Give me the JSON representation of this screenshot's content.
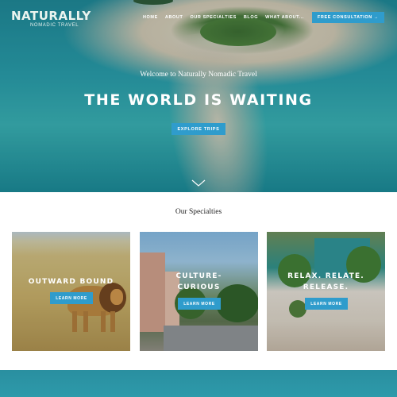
{
  "logo": {
    "main": "NATURALLY",
    "sub": "NOMADIC TRAVEL"
  },
  "nav": {
    "items": [
      "HOME",
      "ABOUT",
      "OUR SPECIALTIES",
      "BLOG",
      "WHAT ABOUT..."
    ],
    "cta": "FREE CONSULTATION →"
  },
  "hero": {
    "welcome": "Welcome to Naturally Nomadic Travel",
    "headline": "THE WORLD IS WAITING",
    "button": "EXPLORE TRIPS"
  },
  "specialties": {
    "title": "Our Specialties",
    "cards": [
      {
        "title_lines": [
          "OUTWARD BOUND"
        ],
        "button": "LEARN MORE"
      },
      {
        "title_lines": [
          "CULTURE-",
          "CURIOUS"
        ],
        "button": "LEARN MORE"
      },
      {
        "title_lines": [
          "RELAX. RELATE.",
          "RELEASE."
        ],
        "button": "LEARN MORE"
      }
    ]
  },
  "colors": {
    "accent": "#2f9ccc",
    "ocean": "#2aa1ac"
  },
  "icons": {
    "scroll": "chevron-down-icon"
  }
}
